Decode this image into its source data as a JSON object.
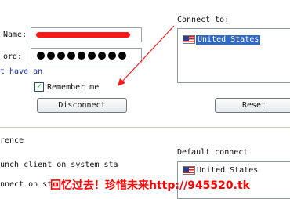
{
  "login": {
    "name_label": "Name:",
    "password_label": "ord:",
    "password_dots": 9,
    "have_account_link": "t have an",
    "remember_label": "Remember me",
    "remember_checked": true,
    "disconnect_button": "Disconnect"
  },
  "connect": {
    "label": "Connect to:",
    "selected_country": "United States",
    "reset_button": "Reset"
  },
  "preferences": {
    "section_label": "rence",
    "launch_option": "unch client on system sta",
    "connect_option": "nnect on st"
  },
  "default_connect": {
    "label": "Default connect",
    "selected_country": "United States"
  },
  "watermark": "回忆过去！珍惜未来http://945520.tk",
  "colors": {
    "selection": "#316ac5",
    "link": "#1a2fa8",
    "annotation": "#ff1a1a"
  }
}
